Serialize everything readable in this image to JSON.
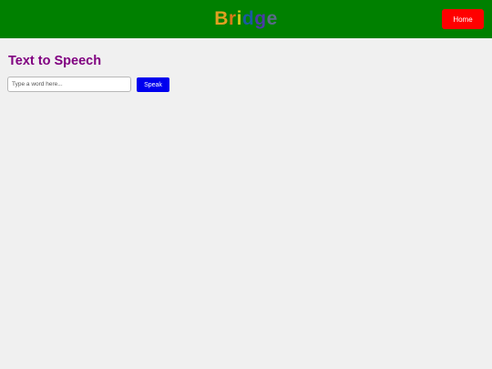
{
  "header": {
    "logo": {
      "letters": [
        {
          "char": "B",
          "color": "#e0a020"
        },
        {
          "char": "r",
          "color": "#d87818"
        },
        {
          "char": "i",
          "color": "#c8c818"
        },
        {
          "char": "d",
          "color": "#1a5aa0"
        },
        {
          "char": "g",
          "color": "#4a3aa8"
        },
        {
          "char": "e",
          "color": "#5a6a88"
        }
      ]
    },
    "home_label": "Home"
  },
  "main": {
    "title": "Text to Speech",
    "input": {
      "placeholder": "Type a word here...",
      "value": ""
    },
    "speak_label": "Speak"
  },
  "colors": {
    "header_bg": "#008000",
    "home_bg": "#ff0000",
    "title_color": "#800080",
    "speak_bg": "#0000ee",
    "page_bg": "#f0f0f0"
  }
}
